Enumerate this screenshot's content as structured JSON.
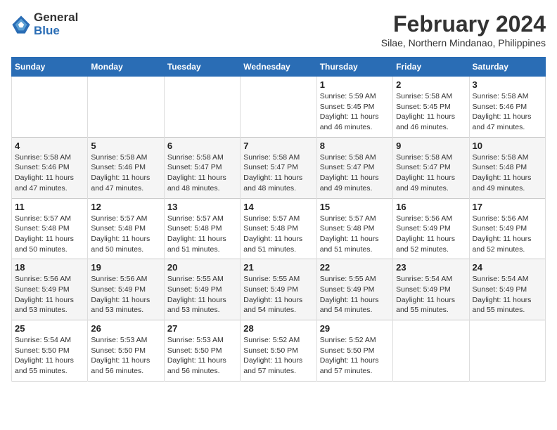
{
  "header": {
    "logo_line1": "General",
    "logo_line2": "Blue",
    "title": "February 2024",
    "subtitle": "Silae, Northern Mindanao, Philippines"
  },
  "days_of_week": [
    "Sunday",
    "Monday",
    "Tuesday",
    "Wednesday",
    "Thursday",
    "Friday",
    "Saturday"
  ],
  "weeks": [
    [
      {
        "day": "",
        "info": ""
      },
      {
        "day": "",
        "info": ""
      },
      {
        "day": "",
        "info": ""
      },
      {
        "day": "",
        "info": ""
      },
      {
        "day": "1",
        "info": "Sunrise: 5:59 AM\nSunset: 5:45 PM\nDaylight: 11 hours\nand 46 minutes."
      },
      {
        "day": "2",
        "info": "Sunrise: 5:58 AM\nSunset: 5:45 PM\nDaylight: 11 hours\nand 46 minutes."
      },
      {
        "day": "3",
        "info": "Sunrise: 5:58 AM\nSunset: 5:46 PM\nDaylight: 11 hours\nand 47 minutes."
      }
    ],
    [
      {
        "day": "4",
        "info": "Sunrise: 5:58 AM\nSunset: 5:46 PM\nDaylight: 11 hours\nand 47 minutes."
      },
      {
        "day": "5",
        "info": "Sunrise: 5:58 AM\nSunset: 5:46 PM\nDaylight: 11 hours\nand 47 minutes."
      },
      {
        "day": "6",
        "info": "Sunrise: 5:58 AM\nSunset: 5:47 PM\nDaylight: 11 hours\nand 48 minutes."
      },
      {
        "day": "7",
        "info": "Sunrise: 5:58 AM\nSunset: 5:47 PM\nDaylight: 11 hours\nand 48 minutes."
      },
      {
        "day": "8",
        "info": "Sunrise: 5:58 AM\nSunset: 5:47 PM\nDaylight: 11 hours\nand 49 minutes."
      },
      {
        "day": "9",
        "info": "Sunrise: 5:58 AM\nSunset: 5:47 PM\nDaylight: 11 hours\nand 49 minutes."
      },
      {
        "day": "10",
        "info": "Sunrise: 5:58 AM\nSunset: 5:48 PM\nDaylight: 11 hours\nand 49 minutes."
      }
    ],
    [
      {
        "day": "11",
        "info": "Sunrise: 5:57 AM\nSunset: 5:48 PM\nDaylight: 11 hours\nand 50 minutes."
      },
      {
        "day": "12",
        "info": "Sunrise: 5:57 AM\nSunset: 5:48 PM\nDaylight: 11 hours\nand 50 minutes."
      },
      {
        "day": "13",
        "info": "Sunrise: 5:57 AM\nSunset: 5:48 PM\nDaylight: 11 hours\nand 51 minutes."
      },
      {
        "day": "14",
        "info": "Sunrise: 5:57 AM\nSunset: 5:48 PM\nDaylight: 11 hours\nand 51 minutes."
      },
      {
        "day": "15",
        "info": "Sunrise: 5:57 AM\nSunset: 5:48 PM\nDaylight: 11 hours\nand 51 minutes."
      },
      {
        "day": "16",
        "info": "Sunrise: 5:56 AM\nSunset: 5:49 PM\nDaylight: 11 hours\nand 52 minutes."
      },
      {
        "day": "17",
        "info": "Sunrise: 5:56 AM\nSunset: 5:49 PM\nDaylight: 11 hours\nand 52 minutes."
      }
    ],
    [
      {
        "day": "18",
        "info": "Sunrise: 5:56 AM\nSunset: 5:49 PM\nDaylight: 11 hours\nand 53 minutes."
      },
      {
        "day": "19",
        "info": "Sunrise: 5:56 AM\nSunset: 5:49 PM\nDaylight: 11 hours\nand 53 minutes."
      },
      {
        "day": "20",
        "info": "Sunrise: 5:55 AM\nSunset: 5:49 PM\nDaylight: 11 hours\nand 53 minutes."
      },
      {
        "day": "21",
        "info": "Sunrise: 5:55 AM\nSunset: 5:49 PM\nDaylight: 11 hours\nand 54 minutes."
      },
      {
        "day": "22",
        "info": "Sunrise: 5:55 AM\nSunset: 5:49 PM\nDaylight: 11 hours\nand 54 minutes."
      },
      {
        "day": "23",
        "info": "Sunrise: 5:54 AM\nSunset: 5:49 PM\nDaylight: 11 hours\nand 55 minutes."
      },
      {
        "day": "24",
        "info": "Sunrise: 5:54 AM\nSunset: 5:49 PM\nDaylight: 11 hours\nand 55 minutes."
      }
    ],
    [
      {
        "day": "25",
        "info": "Sunrise: 5:54 AM\nSunset: 5:50 PM\nDaylight: 11 hours\nand 55 minutes."
      },
      {
        "day": "26",
        "info": "Sunrise: 5:53 AM\nSunset: 5:50 PM\nDaylight: 11 hours\nand 56 minutes."
      },
      {
        "day": "27",
        "info": "Sunrise: 5:53 AM\nSunset: 5:50 PM\nDaylight: 11 hours\nand 56 minutes."
      },
      {
        "day": "28",
        "info": "Sunrise: 5:52 AM\nSunset: 5:50 PM\nDaylight: 11 hours\nand 57 minutes."
      },
      {
        "day": "29",
        "info": "Sunrise: 5:52 AM\nSunset: 5:50 PM\nDaylight: 11 hours\nand 57 minutes."
      },
      {
        "day": "",
        "info": ""
      },
      {
        "day": "",
        "info": ""
      }
    ]
  ]
}
